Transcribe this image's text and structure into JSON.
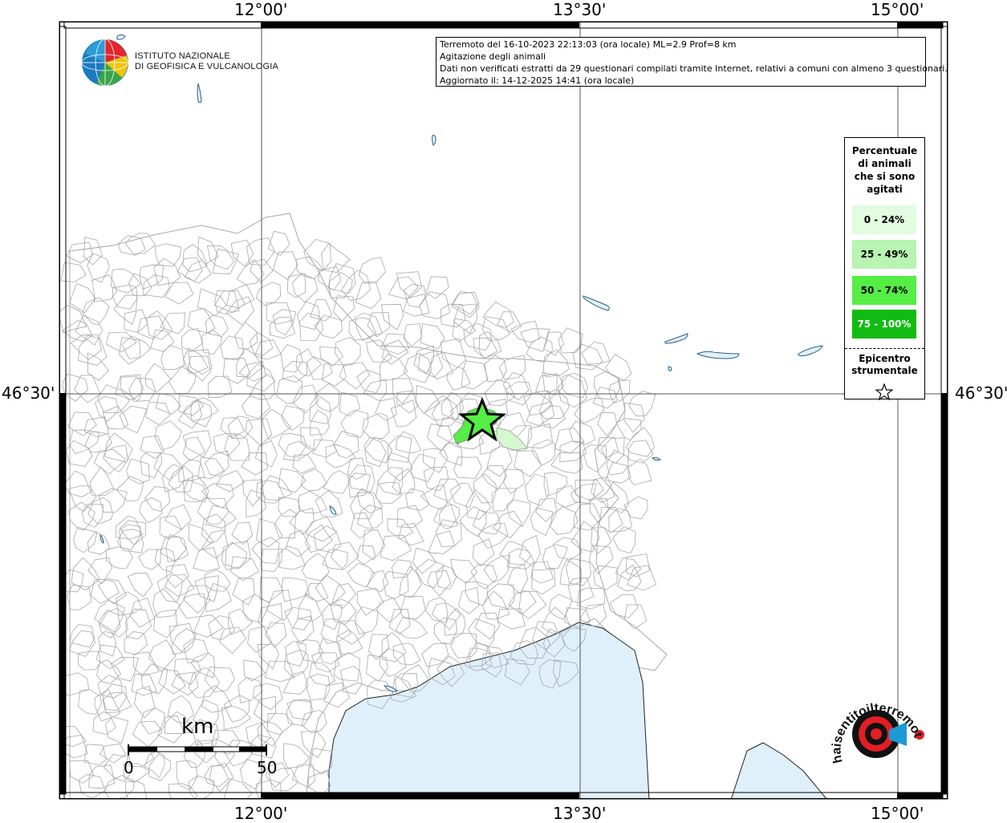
{
  "header": {
    "longitude_ticks": [
      "12°00'",
      "13°30'",
      "15°00'"
    ],
    "latitude_tick": "46°30'"
  },
  "info": {
    "line1": "Terremoto del 16-10-2023 22:13:03 (ora locale) ML=2.9 Prof=8 km",
    "line2": "Agitazione degli animali",
    "line3": "Dati non verificati estratti da 29 questionari compilati tramite Internet, relativi a comuni con almeno 3 questionari.",
    "line4": "Aggiornato il: 14-12-2025 14:41 (ora locale)"
  },
  "legend": {
    "title_lines": [
      "Percentuale",
      "di animali",
      "che si sono",
      "agitati"
    ],
    "classes": [
      {
        "label": "0 - 24%",
        "color": "#e2fbe1"
      },
      {
        "label": "25 - 49%",
        "color": "#b8f4b2"
      },
      {
        "label": "50 - 74%",
        "color": "#55ee44"
      },
      {
        "label": "75 - 100%",
        "color": "#11bb11"
      }
    ],
    "epicenter_label_lines": [
      "Epicentro",
      "strumentale"
    ]
  },
  "logo": {
    "lines": [
      "ISTITUTO NAZIONALE",
      "DI GEOFISICA E VULCANOLOGIA"
    ]
  },
  "scale_bar": {
    "unit": "km",
    "start_label": "0",
    "end_label": "50"
  },
  "badge": {
    "text": "haisentitoilterremoto.it",
    "url_prefix": "www."
  },
  "colors": {
    "sea": "#dff0fb",
    "lake_stroke": "#2f5f7a",
    "border": "#a8a8a8",
    "epicenter_fill": "#55ee44"
  }
}
